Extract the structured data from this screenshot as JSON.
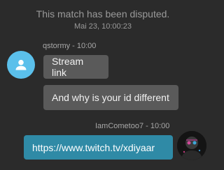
{
  "system": {
    "message": "This match has been disputed.",
    "timestamp": "Mai 23, 10:00:23"
  },
  "messages": [
    {
      "sender": "qstormy - 10:00",
      "text": "Stream link"
    },
    {
      "text": "And why is your id different"
    },
    {
      "sender": "IamCometoo7 - 10:00",
      "text": "https://www.twitch.tv/xdiyaar"
    }
  ],
  "colors": {
    "background": "#2b2b2b",
    "incoming_bubble": "#5a5a5a",
    "outgoing_bubble": "#2f8aa6",
    "default_avatar": "#5bc0eb"
  },
  "icons": {
    "default_avatar": "user-icon",
    "profile_avatar": "profile-photo"
  }
}
